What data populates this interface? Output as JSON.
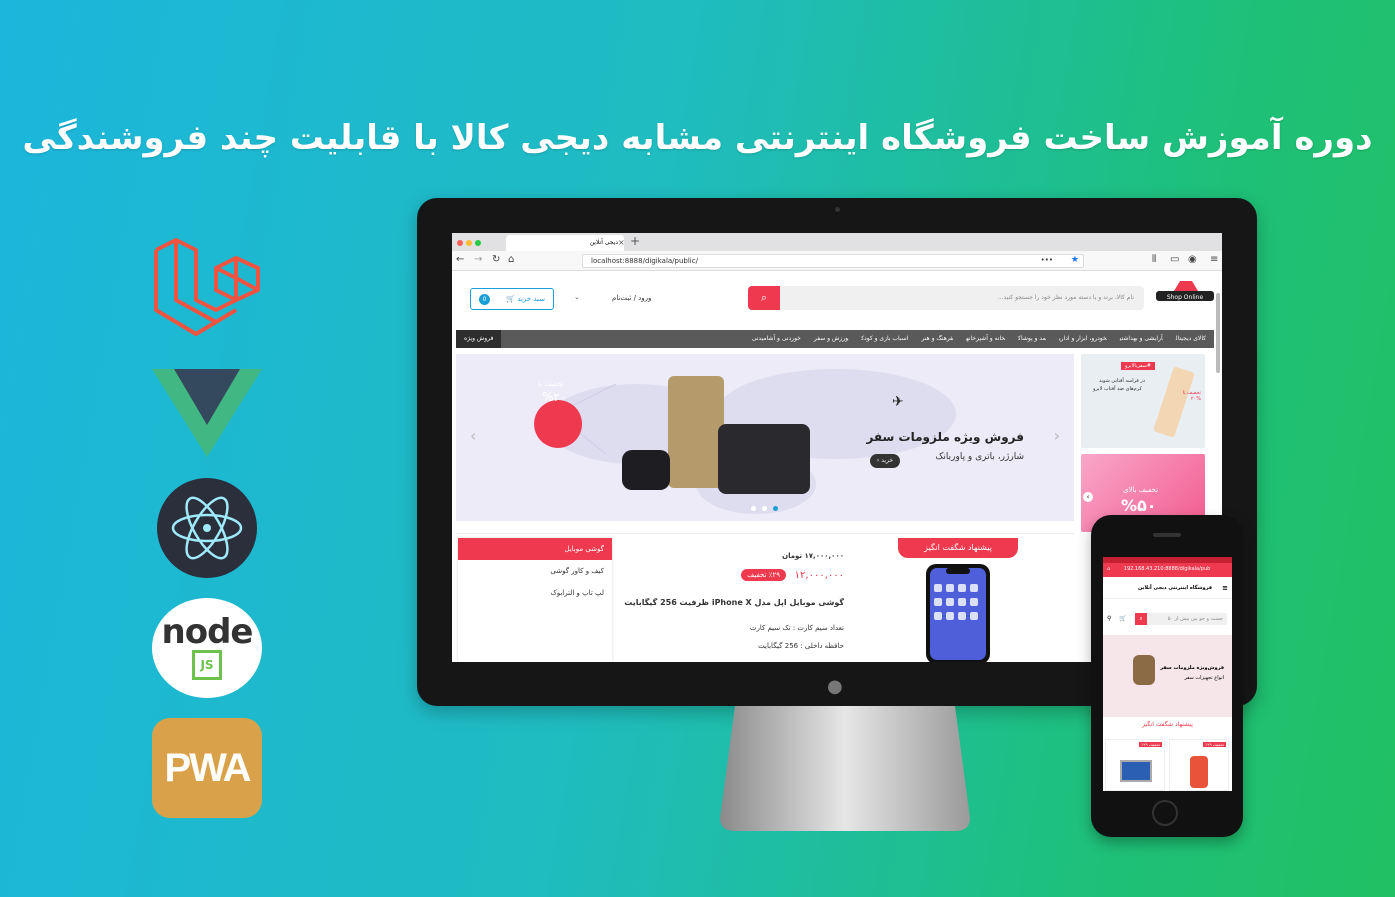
{
  "headline": "دوره آموزش ساخت فروشگاه اینترنتی مشابه دیجی کالا با قابلیت چند فروشندگی",
  "tech_logos": [
    "laravel-logo",
    "vue-logo",
    "electron-logo",
    "nodejs-logo",
    "pwa-logo"
  ],
  "tech_text": {
    "node": "node",
    "js": "JS",
    "pwa": "PWA"
  },
  "browser": {
    "tab_title": "دیجی آنلاین",
    "new_tab": "+",
    "url": "localhost:8888/digikala/public/",
    "url_dots": "•••"
  },
  "site": {
    "logo_text": "Shop Online",
    "search_placeholder": "نام کالا، برند و یا دسته مورد نظر خود را جستجو کنید...",
    "login": "ورود / ثبت‌نام",
    "cart": "سبد خرید",
    "cart_count": "0",
    "categories": [
      "کالای دیجیتال",
      "آرایشی و بهداشتی",
      "خودرو، ابزار و اداری",
      "مد و پوشاک",
      "خانه و آشپزخانه",
      "فرهنگ و هنر",
      "اسباب بازی و کودک",
      "ورزش و سفر",
      "خوردنی و آشامیدنی"
    ],
    "special_sale": "فروش ویژه",
    "slider": {
      "title": "فروش ویژه ملزومات سفر",
      "subtitle": "شارژر، باتری و پاوربانک",
      "button": "خرید",
      "badge_top": "تخفیف تا",
      "badge_value": "%۲۰"
    },
    "side_ad_1": {
      "tag": "#سفربا‌لایرو",
      "text": "در فراسه آفتابی شوید",
      "text2": "کرم‌های ضد آفتاب لایرو",
      "badge": "تخفیف تا %۲۰"
    },
    "side_ad_2": {
      "text": "تخفیف بالای",
      "value": "%۵۰"
    },
    "amazing": {
      "label": "پیشنهاد شگفت انگیز",
      "tabs": [
        "گوشی موبایل",
        "کیف و کاور گوشی",
        "لپ تاپ و الترابوک"
      ],
      "old_price": "۱۷,۰۰۰,۰۰۰ تومان",
      "new_price": "۱۲,۰۰۰,۰۰۰",
      "discount": "٪۲۹ تخفیف",
      "product_name": "گوشی موبایل اپل مدل iPhone X ظرفیت 256 گیگابایت",
      "spec1": "تعداد سیم کارت : تک سیم کارت",
      "spec2": "حافظه داخلی : 256 گیگابایت"
    }
  },
  "phone": {
    "url": "192.168.43.210:8888/digikala/pub",
    "header": "فروشگاه اینترنتی دیجی آنلاین",
    "search": "جست و جو بین بیش از ۵۰",
    "slider_title": "فروش‌ویژه ملزومات سفر",
    "slider_sub": "انواع تجهیزات سفر",
    "amazing": "پیشنهاد شگفت انگیز",
    "discount": "٪۲۹ تخفیف"
  },
  "colors": {
    "accent": "#ef394e",
    "blue": "#1a9fd9",
    "laravel": "#f05340",
    "vue_green": "#41b883",
    "vue_dark": "#35495e",
    "electron_bg": "#2b2e3b",
    "pwa_bg": "#d9a24a"
  }
}
